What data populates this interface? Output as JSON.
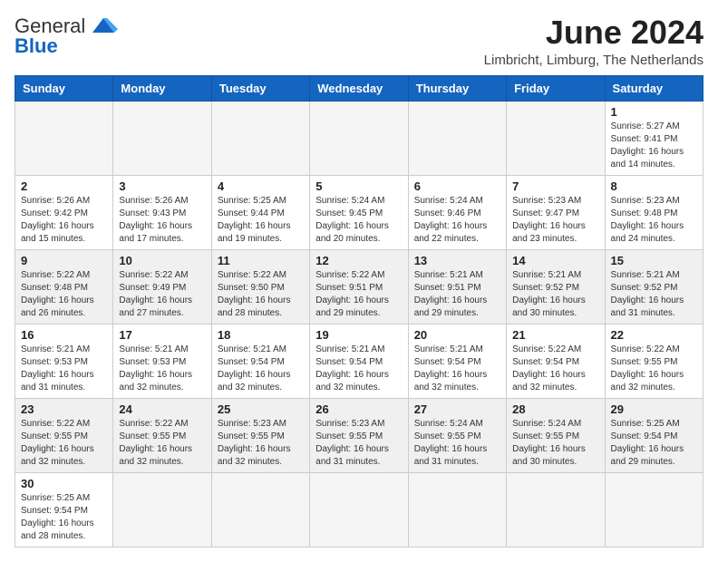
{
  "logo": {
    "general": "General",
    "blue": "Blue"
  },
  "title": "June 2024",
  "subtitle": "Limbricht, Limburg, The Netherlands",
  "weekdays": [
    "Sunday",
    "Monday",
    "Tuesday",
    "Wednesday",
    "Thursday",
    "Friday",
    "Saturday"
  ],
  "weeks": [
    [
      {
        "day": "",
        "info": "",
        "empty": true
      },
      {
        "day": "",
        "info": "",
        "empty": true
      },
      {
        "day": "",
        "info": "",
        "empty": true
      },
      {
        "day": "",
        "info": "",
        "empty": true
      },
      {
        "day": "",
        "info": "",
        "empty": true
      },
      {
        "day": "",
        "info": "",
        "empty": true
      },
      {
        "day": "1",
        "info": "Sunrise: 5:27 AM\nSunset: 9:41 PM\nDaylight: 16 hours\nand 14 minutes."
      }
    ],
    [
      {
        "day": "2",
        "info": "Sunrise: 5:26 AM\nSunset: 9:42 PM\nDaylight: 16 hours\nand 15 minutes."
      },
      {
        "day": "3",
        "info": "Sunrise: 5:26 AM\nSunset: 9:43 PM\nDaylight: 16 hours\nand 17 minutes."
      },
      {
        "day": "4",
        "info": "Sunrise: 5:25 AM\nSunset: 9:44 PM\nDaylight: 16 hours\nand 19 minutes."
      },
      {
        "day": "5",
        "info": "Sunrise: 5:24 AM\nSunset: 9:45 PM\nDaylight: 16 hours\nand 20 minutes."
      },
      {
        "day": "6",
        "info": "Sunrise: 5:24 AM\nSunset: 9:46 PM\nDaylight: 16 hours\nand 22 minutes."
      },
      {
        "day": "7",
        "info": "Sunrise: 5:23 AM\nSunset: 9:47 PM\nDaylight: 16 hours\nand 23 minutes."
      },
      {
        "day": "8",
        "info": "Sunrise: 5:23 AM\nSunset: 9:48 PM\nDaylight: 16 hours\nand 24 minutes."
      }
    ],
    [
      {
        "day": "9",
        "info": "Sunrise: 5:22 AM\nSunset: 9:48 PM\nDaylight: 16 hours\nand 26 minutes."
      },
      {
        "day": "10",
        "info": "Sunrise: 5:22 AM\nSunset: 9:49 PM\nDaylight: 16 hours\nand 27 minutes."
      },
      {
        "day": "11",
        "info": "Sunrise: 5:22 AM\nSunset: 9:50 PM\nDaylight: 16 hours\nand 28 minutes."
      },
      {
        "day": "12",
        "info": "Sunrise: 5:22 AM\nSunset: 9:51 PM\nDaylight: 16 hours\nand 29 minutes."
      },
      {
        "day": "13",
        "info": "Sunrise: 5:21 AM\nSunset: 9:51 PM\nDaylight: 16 hours\nand 29 minutes."
      },
      {
        "day": "14",
        "info": "Sunrise: 5:21 AM\nSunset: 9:52 PM\nDaylight: 16 hours\nand 30 minutes."
      },
      {
        "day": "15",
        "info": "Sunrise: 5:21 AM\nSunset: 9:52 PM\nDaylight: 16 hours\nand 31 minutes."
      }
    ],
    [
      {
        "day": "16",
        "info": "Sunrise: 5:21 AM\nSunset: 9:53 PM\nDaylight: 16 hours\nand 31 minutes."
      },
      {
        "day": "17",
        "info": "Sunrise: 5:21 AM\nSunset: 9:53 PM\nDaylight: 16 hours\nand 32 minutes."
      },
      {
        "day": "18",
        "info": "Sunrise: 5:21 AM\nSunset: 9:54 PM\nDaylight: 16 hours\nand 32 minutes."
      },
      {
        "day": "19",
        "info": "Sunrise: 5:21 AM\nSunset: 9:54 PM\nDaylight: 16 hours\nand 32 minutes."
      },
      {
        "day": "20",
        "info": "Sunrise: 5:21 AM\nSunset: 9:54 PM\nDaylight: 16 hours\nand 32 minutes."
      },
      {
        "day": "21",
        "info": "Sunrise: 5:22 AM\nSunset: 9:54 PM\nDaylight: 16 hours\nand 32 minutes."
      },
      {
        "day": "22",
        "info": "Sunrise: 5:22 AM\nSunset: 9:55 PM\nDaylight: 16 hours\nand 32 minutes."
      }
    ],
    [
      {
        "day": "23",
        "info": "Sunrise: 5:22 AM\nSunset: 9:55 PM\nDaylight: 16 hours\nand 32 minutes."
      },
      {
        "day": "24",
        "info": "Sunrise: 5:22 AM\nSunset: 9:55 PM\nDaylight: 16 hours\nand 32 minutes."
      },
      {
        "day": "25",
        "info": "Sunrise: 5:23 AM\nSunset: 9:55 PM\nDaylight: 16 hours\nand 32 minutes."
      },
      {
        "day": "26",
        "info": "Sunrise: 5:23 AM\nSunset: 9:55 PM\nDaylight: 16 hours\nand 31 minutes."
      },
      {
        "day": "27",
        "info": "Sunrise: 5:24 AM\nSunset: 9:55 PM\nDaylight: 16 hours\nand 31 minutes."
      },
      {
        "day": "28",
        "info": "Sunrise: 5:24 AM\nSunset: 9:55 PM\nDaylight: 16 hours\nand 30 minutes."
      },
      {
        "day": "29",
        "info": "Sunrise: 5:25 AM\nSunset: 9:54 PM\nDaylight: 16 hours\nand 29 minutes."
      }
    ],
    [
      {
        "day": "30",
        "info": "Sunrise: 5:25 AM\nSunset: 9:54 PM\nDaylight: 16 hours\nand 28 minutes."
      },
      {
        "day": "",
        "info": "",
        "empty": true
      },
      {
        "day": "",
        "info": "",
        "empty": true
      },
      {
        "day": "",
        "info": "",
        "empty": true
      },
      {
        "day": "",
        "info": "",
        "empty": true
      },
      {
        "day": "",
        "info": "",
        "empty": true
      },
      {
        "day": "",
        "info": "",
        "empty": true
      }
    ]
  ]
}
